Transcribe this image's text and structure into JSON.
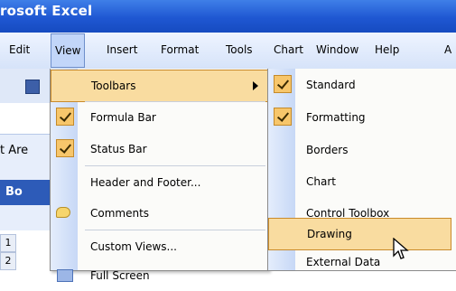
{
  "window": {
    "title": "rosoft Excel"
  },
  "menubar": {
    "items": [
      "Edit",
      "View",
      "Insert",
      "Format",
      "Tools",
      "Chart",
      "Window",
      "Help",
      "A"
    ]
  },
  "app": {
    "area_label": "t Are",
    "book_tab": "Bo",
    "row_numbers": [
      "1",
      "2"
    ]
  },
  "view_menu": {
    "items": [
      {
        "label": "Toolbars",
        "submenu": true,
        "highlighted": true
      },
      {
        "label": "Formula Bar",
        "checked": true
      },
      {
        "label": "Status Bar",
        "checked": true
      },
      {
        "label": "Header and Footer..."
      },
      {
        "label": "Comments",
        "icon": "comments-icon"
      },
      {
        "label": "Custom Views..."
      },
      {
        "label": "Full Screen",
        "icon": "full-screen-icon"
      }
    ]
  },
  "toolbars_submenu": {
    "items": [
      {
        "label": "Standard",
        "checked": true
      },
      {
        "label": "Formatting",
        "checked": true
      },
      {
        "label": "Borders"
      },
      {
        "label": "Chart"
      },
      {
        "label": "Control Toolbox"
      },
      {
        "label": "Drawing",
        "highlighted": true
      },
      {
        "label": "External Data"
      }
    ]
  },
  "colors": {
    "titlebar": "#1f57d2",
    "highlight": "#f9dca0",
    "highlight_border": "#c98a2a",
    "gutter": "#c7d8f6"
  },
  "cursor": {
    "icon": "mouse-pointer-icon"
  }
}
